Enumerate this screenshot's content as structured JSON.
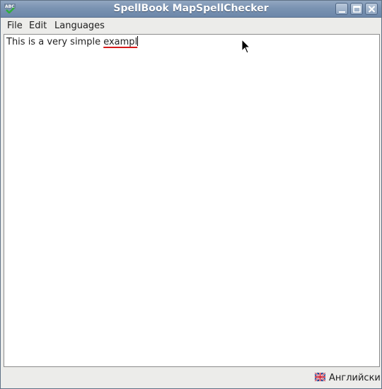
{
  "window": {
    "title": "SpellBook MapSpellChecker",
    "icon": "abc-check-icon",
    "controls": [
      "minimize-icon",
      "maximize-icon",
      "close-icon"
    ]
  },
  "menubar": {
    "items": [
      {
        "label": "File"
      },
      {
        "label": "Edit"
      },
      {
        "label": "Languages"
      }
    ]
  },
  "editor": {
    "text_plain": "This is a very simple ",
    "text_misspelled": "exampl",
    "misspelled_color": "#d61a1a"
  },
  "statusbar": {
    "language_flag": "uk-flag-icon",
    "language_label": "Английски"
  }
}
